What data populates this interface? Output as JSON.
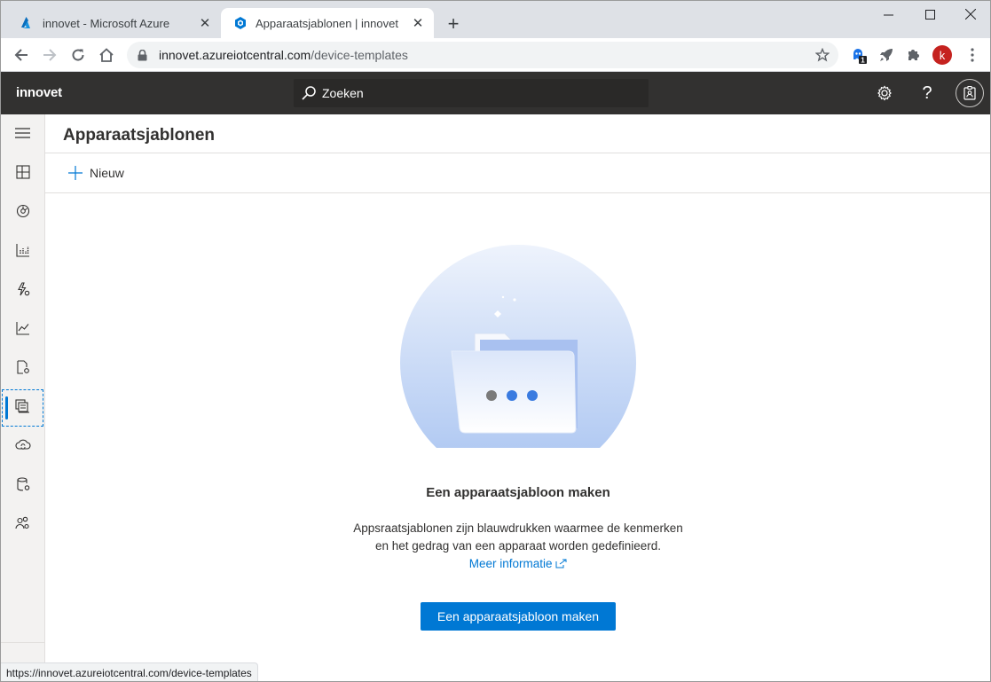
{
  "browser": {
    "tabs": [
      {
        "title": "innovet - Microsoft Azure",
        "icon": "azure-logo-icon"
      },
      {
        "title": "Apparaatsjablonen | innovet",
        "icon": "iot-central-icon",
        "active": true
      }
    ],
    "url_host": "innovet.azureiotcentral.com",
    "url_path": "/device-templates",
    "extension_badge": "1",
    "profile_initial": "k",
    "status_url": "https://innovet.azureiotcentral.com/device-templates"
  },
  "app": {
    "brand": "innovet",
    "search_placeholder": "Zoeken"
  },
  "nav": [
    {
      "name": "nav-menu",
      "icon": "hamburger-icon"
    },
    {
      "name": "nav-dashboard",
      "icon": "dashboard-icon"
    },
    {
      "name": "nav-devices",
      "icon": "devices-icon"
    },
    {
      "name": "nav-device-groups",
      "icon": "device-groups-icon"
    },
    {
      "name": "nav-rules",
      "icon": "rules-icon"
    },
    {
      "name": "nav-analytics",
      "icon": "analytics-icon"
    },
    {
      "name": "nav-jobs",
      "icon": "jobs-icon"
    },
    {
      "name": "nav-device-templates",
      "icon": "device-templates-icon",
      "selected": true
    },
    {
      "name": "nav-data-export",
      "icon": "data-export-icon"
    },
    {
      "name": "nav-administration",
      "icon": "administration-icon"
    },
    {
      "name": "nav-users",
      "icon": "users-icon"
    }
  ],
  "page": {
    "title": "Apparaatsjablonen",
    "new_label": "Nieuw",
    "empty_title": "Een apparaatsjabloon maken",
    "empty_desc_line1": "Appsraatsjablonen zijn blauwdrukken waarmee de kenmerken",
    "empty_desc_line2": "en het gedrag van een apparaat worden gedefinieerd.",
    "more_info": "Meer informatie",
    "create_button": "Een apparaatsjabloon maken"
  },
  "colors": {
    "accent": "#0078d4",
    "header": "#323130",
    "nav_bg": "#f3f2f1"
  }
}
